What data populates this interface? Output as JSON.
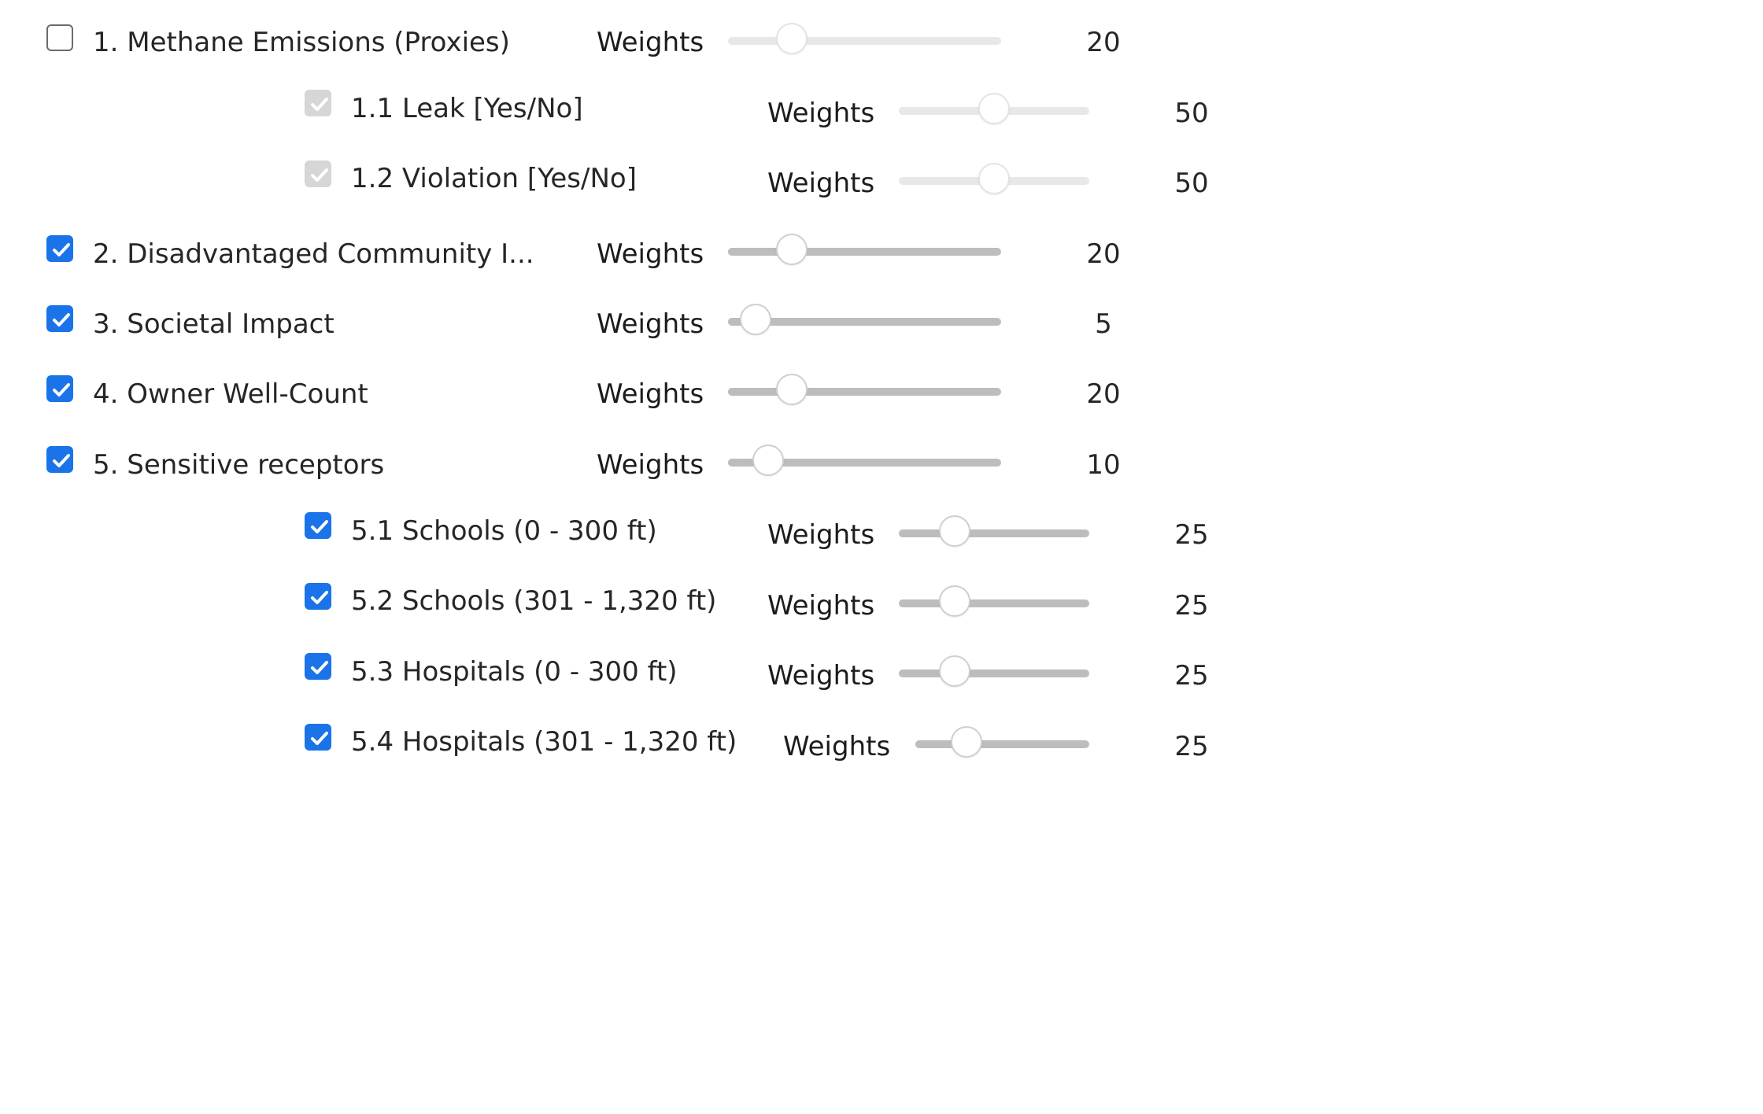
{
  "criteria": [
    {
      "label": "1. Methane Emissions (Proxies)",
      "weights_label": "Weights",
      "value": "20",
      "level": 0.2,
      "checked": false,
      "disabled": false,
      "slider_disabled": true
    },
    {
      "label": "1.1 Leak [Yes/No]",
      "weights_label": "Weights",
      "value": "50",
      "level": 0.5,
      "checked": true,
      "disabled": true,
      "slider_disabled": true
    },
    {
      "label": "1.2 Violation [Yes/No]",
      "weights_label": "Weights",
      "value": "50",
      "level": 0.5,
      "checked": true,
      "disabled": true,
      "slider_disabled": true
    },
    {
      "label": "2. Disadvantaged Community I...",
      "weights_label": "Weights",
      "value": "20",
      "level": 0.2,
      "checked": true,
      "disabled": false,
      "slider_disabled": false
    },
    {
      "label": "3. Societal Impact",
      "weights_label": "Weights",
      "value": "5",
      "level": 0.05,
      "checked": true,
      "disabled": false,
      "slider_disabled": false
    },
    {
      "label": "4. Owner Well-Count",
      "weights_label": "Weights",
      "value": "20",
      "level": 0.2,
      "checked": true,
      "disabled": false,
      "slider_disabled": false
    },
    {
      "label": "5. Sensitive receptors",
      "weights_label": "Weights",
      "value": "10",
      "level": 0.1,
      "checked": true,
      "disabled": false,
      "slider_disabled": false
    },
    {
      "label": "5.1 Schools (0 - 300 ft)",
      "weights_label": "Weights",
      "value": "25",
      "level": 0.25,
      "checked": true,
      "disabled": false,
      "slider_disabled": false
    },
    {
      "label": "5.2 Schools (301 - 1,320 ft)",
      "weights_label": "Weights",
      "value": "25",
      "level": 0.25,
      "checked": true,
      "disabled": false,
      "slider_disabled": false
    },
    {
      "label": "5.3 Hospitals (0 - 300 ft)",
      "weights_label": "Weights",
      "value": "25",
      "level": 0.25,
      "checked": true,
      "disabled": false,
      "slider_disabled": false
    },
    {
      "label": "5.4 Hospitals (301 - 1,320 ft)",
      "weights_label": "Weights",
      "value": "25",
      "level": 0.25,
      "checked": true,
      "disabled": false,
      "slider_disabled": false
    }
  ]
}
